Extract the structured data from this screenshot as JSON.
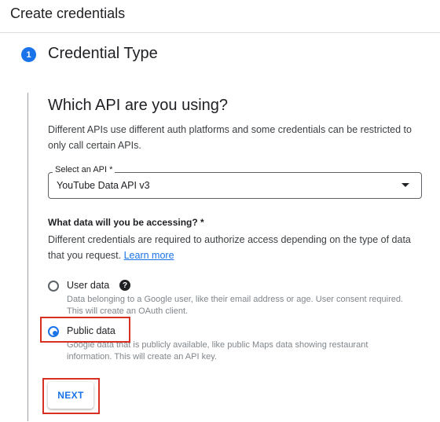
{
  "header": {
    "title": "Create credentials"
  },
  "step": {
    "number": "1",
    "title": "Credential Type"
  },
  "api_section": {
    "title": "Which API are you using?",
    "description": "Different APIs use different auth platforms and some credentials can be restricted to only call certain APIs.",
    "select": {
      "label": "Select an API *",
      "value": "YouTube Data API v3"
    }
  },
  "data_section": {
    "question": "What data will you be accessing? *",
    "description_prefix": "Different credentials are required to authorize access depending on the type of data that you request.",
    "learn_more": "Learn more",
    "options": [
      {
        "label": "User data",
        "hint": "Data belonging to a Google user, like their email address or age. User consent required. This will create an OAuth client.",
        "selected": false
      },
      {
        "label": "Public data",
        "hint": "Google data that is publicly available, like public Maps data showing restaurant information. This will create an API key.",
        "selected": true
      }
    ]
  },
  "actions": {
    "next_label": "NEXT"
  },
  "colors": {
    "accent": "#1a73e8",
    "highlight": "#d93025"
  },
  "icons": {
    "help": "help-circle-icon",
    "dropdown": "triangle-down-icon"
  }
}
